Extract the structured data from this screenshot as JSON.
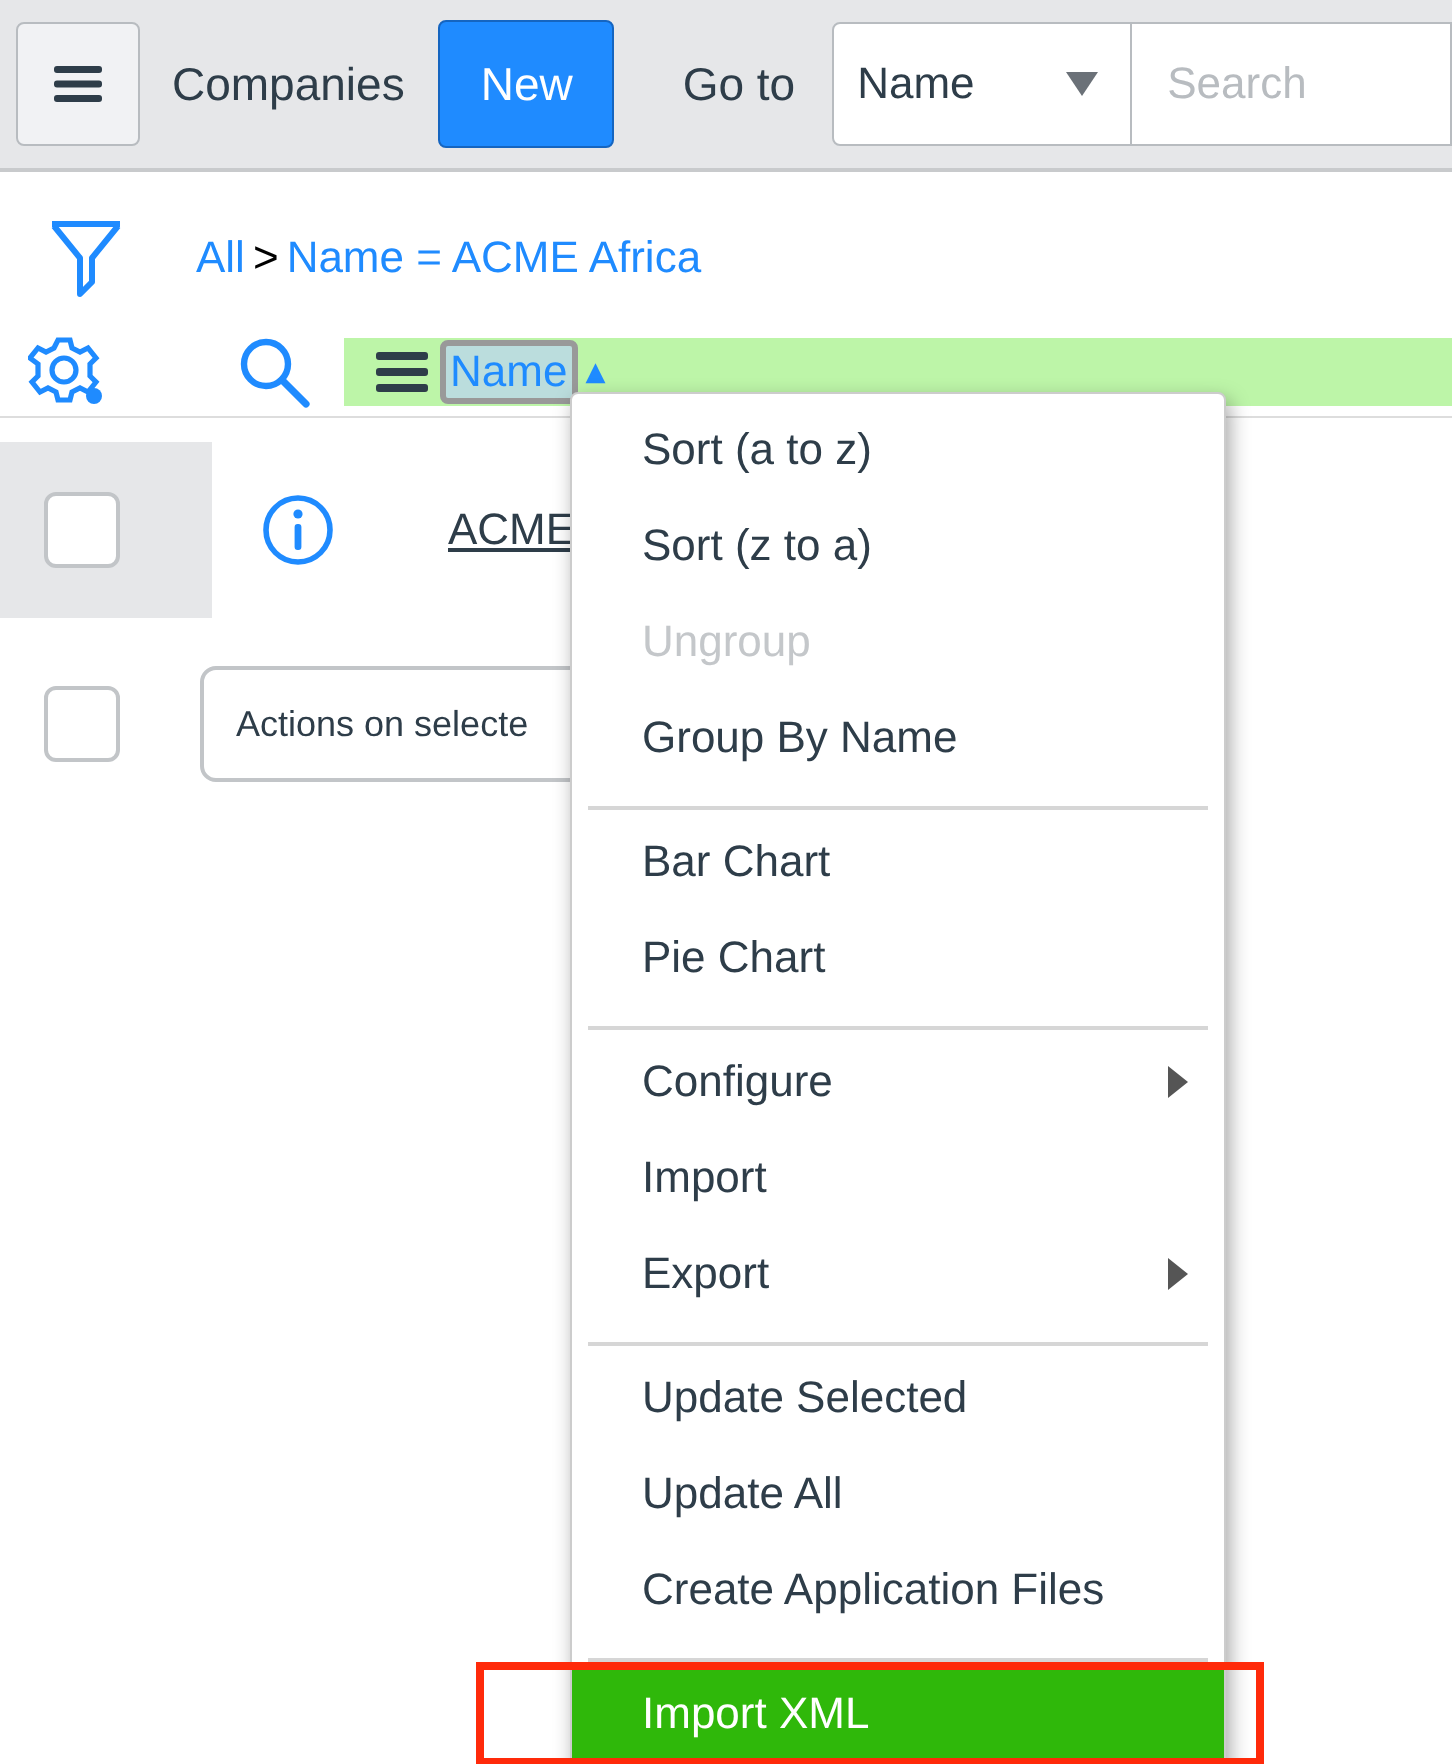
{
  "header": {
    "title": "Companies",
    "new_button": "New",
    "goto_label": "Go to",
    "goto_select": "Name",
    "search": {
      "placeholder": "Search"
    }
  },
  "breadcrumb": {
    "root": "All",
    "separator": ">",
    "filter": "Name = ACME Africa"
  },
  "column_header": {
    "label": "Name",
    "sort_indicator": "▲"
  },
  "rows": [
    {
      "checked": false,
      "name": "ACME"
    }
  ],
  "actions": {
    "checked": false,
    "select": "Actions on selecte"
  },
  "context_menu": {
    "groups": [
      {
        "items": [
          {
            "label": "Sort (a to z)",
            "disabled": false,
            "submenu": false,
            "selected": false
          },
          {
            "label": "Sort (z to a)",
            "disabled": false,
            "submenu": false,
            "selected": false
          },
          {
            "label": "Ungroup",
            "disabled": true,
            "submenu": false,
            "selected": false
          },
          {
            "label": "Group By Name",
            "disabled": false,
            "submenu": false,
            "selected": false
          }
        ]
      },
      {
        "items": [
          {
            "label": "Bar Chart",
            "disabled": false,
            "submenu": false,
            "selected": false
          },
          {
            "label": "Pie Chart",
            "disabled": false,
            "submenu": false,
            "selected": false
          }
        ]
      },
      {
        "items": [
          {
            "label": "Configure",
            "disabled": false,
            "submenu": true,
            "selected": false
          },
          {
            "label": "Import",
            "disabled": false,
            "submenu": false,
            "selected": false
          },
          {
            "label": "Export",
            "disabled": false,
            "submenu": true,
            "selected": false
          }
        ]
      },
      {
        "items": [
          {
            "label": "Update Selected",
            "disabled": false,
            "submenu": false,
            "selected": false
          },
          {
            "label": "Update All",
            "disabled": false,
            "submenu": false,
            "selected": false
          },
          {
            "label": "Create Application Files",
            "disabled": false,
            "submenu": false,
            "selected": false
          }
        ]
      },
      {
        "items": [
          {
            "label": "Import XML",
            "disabled": false,
            "submenu": false,
            "selected": true
          }
        ]
      }
    ]
  }
}
